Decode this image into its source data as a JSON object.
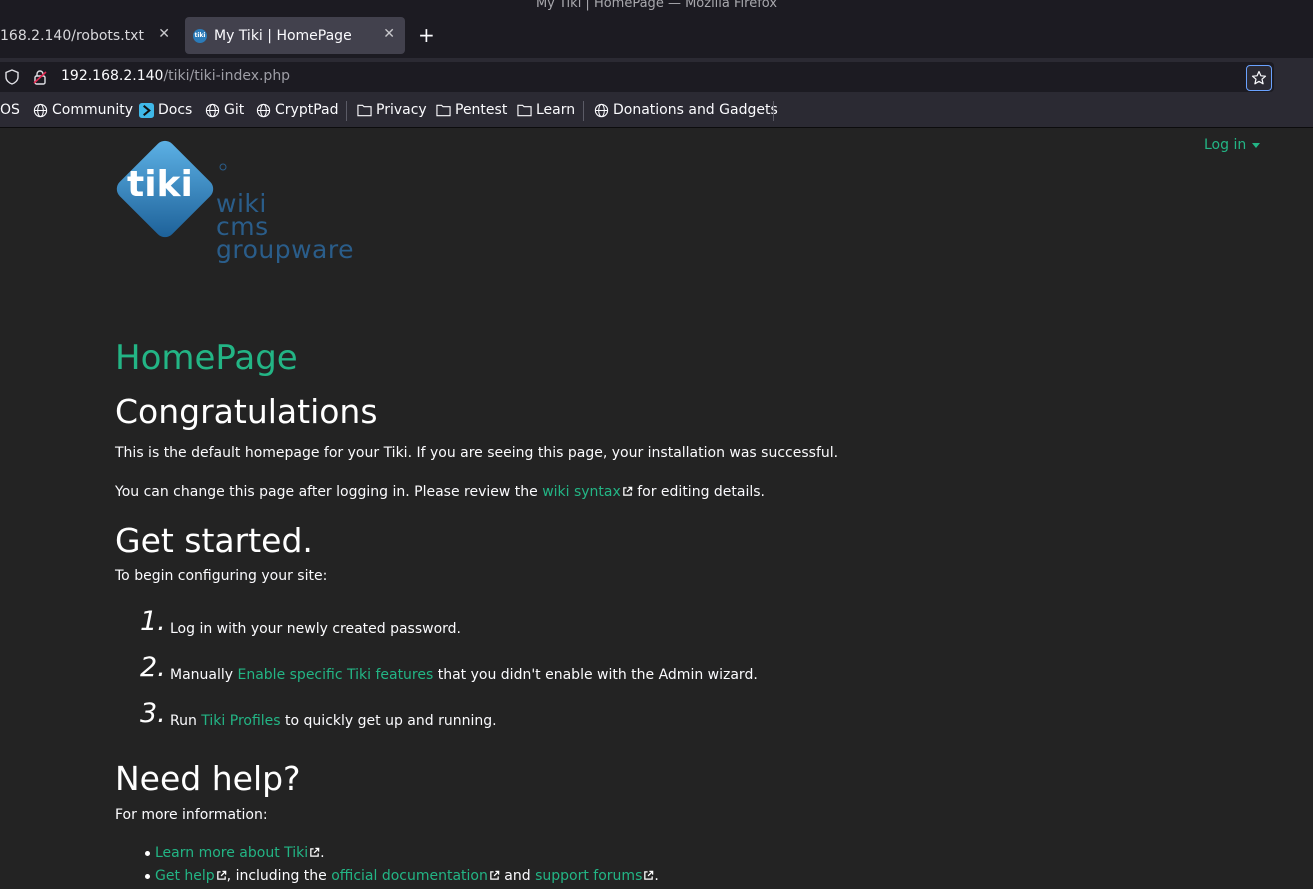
{
  "window": {
    "title": "My Tiki | HomePage — Mozilla Firefox"
  },
  "tabs": [
    {
      "label": "168.2.140/robots.txt"
    },
    {
      "label": "My Tiki | HomePage",
      "favicon_text": "tiki"
    }
  ],
  "toolbar": {
    "url_host": "192.168.2.140",
    "url_path": "/tiki/tiki-index.php"
  },
  "bookmarks": [
    {
      "label": "OS",
      "icon": "none"
    },
    {
      "label": "Community",
      "icon": "globe-icon"
    },
    {
      "label": "Docs",
      "icon": "docs-icon"
    },
    {
      "label": "Git",
      "icon": "globe-icon"
    },
    {
      "label": "CryptPad",
      "icon": "globe-icon"
    },
    {
      "label": "Privacy",
      "icon": "folder-icon"
    },
    {
      "label": "Pentest",
      "icon": "folder-icon"
    },
    {
      "label": "Learn",
      "icon": "folder-icon"
    },
    {
      "label": "Donations and Gadgets",
      "icon": "globe-icon"
    }
  ],
  "header": {
    "login": "Log in",
    "logo_text": "tiki",
    "logo_wordmark": [
      "wiki",
      "cms",
      "groupware"
    ]
  },
  "main": {
    "page_title": "HomePage",
    "congrats_heading": "Congratulations",
    "intro_1": "This is the default homepage for your Tiki. If you are seeing this page, your installation was successful.",
    "intro_2_pre": "You can change this page after logging in. Please review the ",
    "intro_2_link": "wiki syntax",
    "intro_2_post": " for editing details.",
    "get_started_heading": "Get started.",
    "get_started_intro": "To begin configuring your site:",
    "steps": [
      {
        "num": "1.",
        "pre": "Log in with your newly created password.",
        "link": "",
        "post": ""
      },
      {
        "num": "2.",
        "pre": "Manually ",
        "link": "Enable specific Tiki features",
        "post": " that you didn't enable with the Admin wizard."
      },
      {
        "num": "3.",
        "pre": "Run ",
        "link": "Tiki Profiles",
        "post": " to quickly get up and running."
      }
    ],
    "help_heading": "Need help?",
    "help_intro": "For more information:",
    "help_items": [
      {
        "link1": "Learn more about Tiki",
        "mid": ".",
        "link2": "",
        "mid2": "",
        "link3": "",
        "end": ""
      },
      {
        "link1": "Get help",
        "mid": ", including the ",
        "link2": "official documentation",
        "mid2": " and ",
        "link3": "support forums",
        "end": "."
      }
    ]
  },
  "colors": {
    "accent": "#23b585",
    "background": "#232323",
    "logo_blue": "#2a5d8a"
  }
}
